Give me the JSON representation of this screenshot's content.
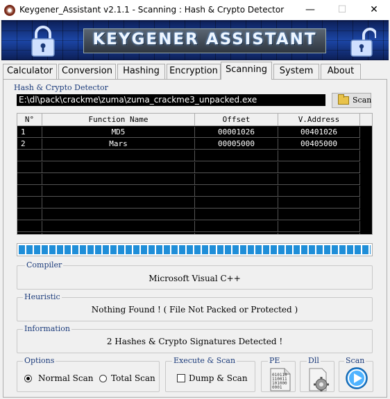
{
  "window": {
    "title": "Keygener_Assistant v2.1.1 - Scanning : Hash & Crypto Detector",
    "minimize": "—",
    "maximize": "☐",
    "close": "✕"
  },
  "banner": {
    "text": "KEYGENER ASSISTANT"
  },
  "tabs": [
    {
      "label": "Calculator"
    },
    {
      "label": "Conversion"
    },
    {
      "label": "Hashing"
    },
    {
      "label": "Encryption"
    },
    {
      "label": "Scanning",
      "active": true
    },
    {
      "label": "System"
    },
    {
      "label": "About"
    }
  ],
  "detector": {
    "group_label": "Hash & Crypto Detector",
    "path": "E:\\dl\\pack\\crackme\\zuma\\zuma_crackme3_unpacked.exe",
    "scan_button": "Scan",
    "columns": [
      "N°",
      "Function Name",
      "Offset",
      "V.Address"
    ],
    "rows": [
      {
        "n": "1",
        "name": "MD5",
        "offset": "00001026",
        "vaddr": "00401026"
      },
      {
        "n": "2",
        "name": "Mars",
        "offset": "00005000",
        "vaddr": "00405000"
      }
    ],
    "progress": 1.0
  },
  "compiler": {
    "label": "Compiler",
    "value": "Microsoft Visual C++"
  },
  "heuristic": {
    "label": "Heuristic",
    "value": "Nothing Found ! ( File Not Packed or Protected )"
  },
  "information": {
    "label": "Information",
    "value": "2 Hashes & Crypto Signatures Detected !"
  },
  "options": {
    "label": "Options",
    "normal_scan": "Normal Scan",
    "normal_scan_checked": true,
    "total_scan": "Total Scan",
    "total_scan_checked": false
  },
  "execute": {
    "label": "Execute & Scan",
    "dump_scan": "Dump & Scan",
    "dump_scan_checked": false
  },
  "pe": {
    "label": "PE",
    "icon": "binary-file-icon",
    "lines": [
      "010110",
      "110011",
      "101000",
      "0001"
    ]
  },
  "dll": {
    "label": "Dll",
    "icon": "dll-gear-icon"
  },
  "scan_action": {
    "label": "Scan",
    "icon": "play-icon"
  },
  "colors": {
    "progress": "#1f8ed8",
    "table_bg": "#000000",
    "banner": "#1c46a6",
    "group_label": "#1a3a7a"
  }
}
